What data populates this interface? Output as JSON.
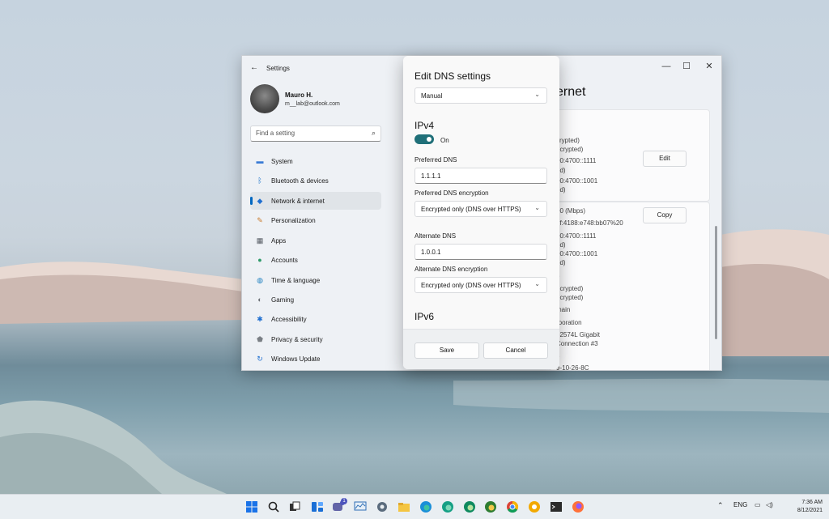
{
  "window": {
    "title": "Settings",
    "back_icon": "back-arrow-icon",
    "min": "—",
    "max": "☐",
    "close": "✕"
  },
  "profile": {
    "name": "Mauro H.",
    "email": "m__lab@outlook.com"
  },
  "search": {
    "placeholder": "Find a setting"
  },
  "nav": [
    {
      "label": "System",
      "icon": "system-icon",
      "color": "#3a7bd5"
    },
    {
      "label": "Bluetooth & devices",
      "icon": "bluetooth-icon",
      "color": "#1a73c9"
    },
    {
      "label": "Network & internet",
      "icon": "network-icon",
      "color": "#1f6fd0"
    },
    {
      "label": "Personalization",
      "icon": "brush-icon",
      "color": "#c97a2c"
    },
    {
      "label": "Apps",
      "icon": "apps-icon",
      "color": "#555b63"
    },
    {
      "label": "Accounts",
      "icon": "accounts-icon",
      "color": "#2e9a6a"
    },
    {
      "label": "Time & language",
      "icon": "globe-icon",
      "color": "#1d7fbf"
    },
    {
      "label": "Gaming",
      "icon": "gaming-icon",
      "color": "#6a6f75"
    },
    {
      "label": "Accessibility",
      "icon": "accessibility-icon",
      "color": "#1f6fd0"
    },
    {
      "label": "Privacy & security",
      "icon": "shield-icon",
      "color": "#7a7f85"
    },
    {
      "label": "Windows Update",
      "icon": "update-icon",
      "color": "#1f6fd0"
    }
  ],
  "main": {
    "title_partial": "ernet",
    "bg_lines_top": [
      "crypted)",
      "ncrypted)",
      "00:4700::1111",
      "ed)",
      "00:4700::1001",
      "ed)"
    ],
    "bg_lines_bottom": [
      "00 (Mbps)",
      "7f:4188:e748:bb07%20",
      "00:4700::1111",
      "ed)",
      "00:4700::1001",
      "ed)",
      "5",
      "ncrypted)",
      "ncrypted)",
      "main",
      "rporation",
      "82574L Gigabit",
      "Connection #3",
      "3",
      "9-10-26-8C"
    ],
    "edit_label": "Edit",
    "copy_label": "Copy"
  },
  "dialog": {
    "title": "Edit DNS settings",
    "mode": "Manual",
    "ipv4_heading": "IPv4",
    "toggle_label": "On",
    "preferred_label": "Preferred DNS",
    "preferred_value": "1.1.1.1",
    "preferred_enc_label": "Preferred DNS encryption",
    "preferred_enc_value": "Encrypted only (DNS over HTTPS)",
    "alternate_label": "Alternate DNS",
    "alternate_value": "1.0.0.1",
    "alternate_enc_label": "Alternate DNS encryption",
    "alternate_enc_value": "Encrypted only (DNS over HTTPS)",
    "ipv6_heading": "IPv6",
    "save_label": "Save",
    "cancel_label": "Cancel"
  },
  "taskbar": {
    "apps": [
      "start-icon",
      "search-icon",
      "task-view-icon",
      "widgets-icon",
      "teams-icon",
      "monitor-icon",
      "settings-icon",
      "file-explorer-icon",
      "edge-icon",
      "edge-beta-icon",
      "edge-dev-icon",
      "edge-canary-icon",
      "chrome-icon",
      "chrome-canary-icon",
      "terminal-icon",
      "firefox-icon"
    ],
    "badge": "1",
    "lang": "ENG",
    "time": "7:36 AM",
    "date": "8/12/2021"
  }
}
